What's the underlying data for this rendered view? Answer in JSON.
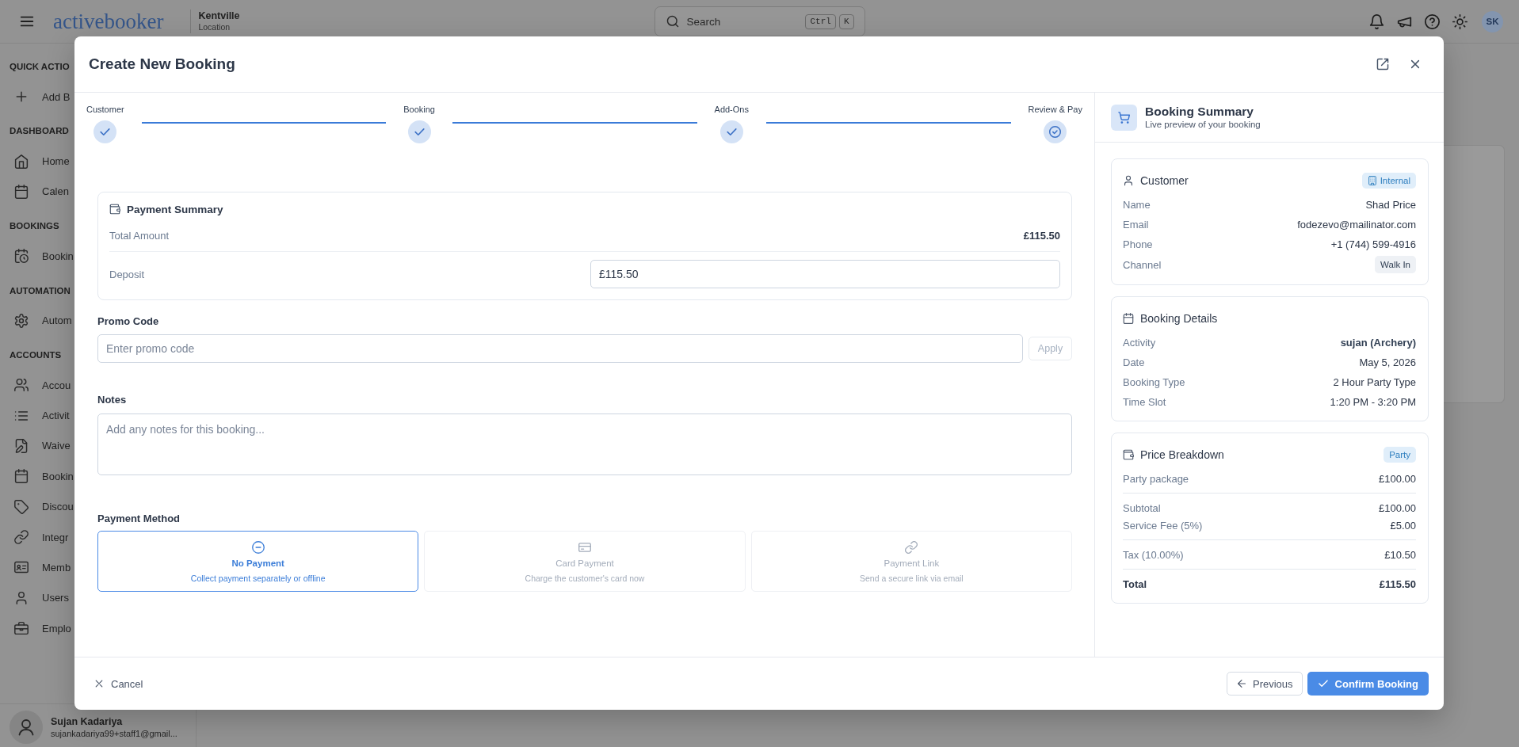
{
  "header": {
    "logo": "activebooker",
    "location": {
      "name": "Kentville",
      "label": "Location"
    },
    "search": {
      "placeholder": "Search",
      "shortcut": [
        "Ctrl",
        "K"
      ]
    },
    "user_initials": "SK"
  },
  "sidebar": {
    "sections": [
      {
        "title": "QUICK ACTIO",
        "items": [
          {
            "label": "Add B"
          }
        ]
      },
      {
        "title": "DASHBOARD",
        "items": [
          {
            "label": "Home"
          },
          {
            "label": "Calen"
          }
        ]
      },
      {
        "title": "BOOKINGS",
        "items": [
          {
            "label": "Bookin"
          }
        ]
      },
      {
        "title": "AUTOMATION",
        "items": [
          {
            "label": "Autom"
          }
        ]
      },
      {
        "title": "ACCOUNTS",
        "items": [
          {
            "label": "Accou"
          },
          {
            "label": "Activit"
          },
          {
            "label": "Waive"
          },
          {
            "label": "Bookin"
          },
          {
            "label": "Discou"
          },
          {
            "label": "Integr"
          },
          {
            "label": "Memb"
          },
          {
            "label": "Users"
          },
          {
            "label": "Emplo"
          }
        ]
      }
    ],
    "user": {
      "name": "Sujan Kadariya",
      "email": "sujankadariya99+staff1@gmail..."
    }
  },
  "modal": {
    "title": "Create New Booking",
    "steps": [
      {
        "label": "Customer",
        "completed": true
      },
      {
        "label": "Booking",
        "completed": true
      },
      {
        "label": "Add-Ons",
        "completed": true
      },
      {
        "label": "Review & Pay",
        "completed": false
      }
    ],
    "payment_summary": {
      "title": "Payment Summary",
      "total_label": "Total Amount",
      "total": "£115.50",
      "deposit_label": "Deposit",
      "deposit": "£115.50"
    },
    "promo": {
      "label": "Promo Code",
      "placeholder": "Enter promo code",
      "button": {
        "label": "Apply",
        "disabled": true
      }
    },
    "notes": {
      "label": "Notes",
      "placeholder": "Add any notes for this booking..."
    },
    "payment_method": {
      "label": "Payment Method",
      "options": [
        {
          "title": "No Payment",
          "description": "Collect payment separately or offline",
          "selected": true
        },
        {
          "title": "Card Payment",
          "description": "Charge the customer's card now",
          "selected": false
        },
        {
          "title": "Payment Link",
          "description": "Send a secure link via email",
          "selected": false
        }
      ]
    },
    "footer": {
      "cancel": "Cancel",
      "previous": "Previous",
      "confirm": "Confirm Booking"
    },
    "summary": {
      "title": "Booking Summary",
      "subtitle": "Live preview of your booking",
      "cards": [
        {
          "title": "Customer",
          "badge": {
            "label": "Internal",
            "kind": "icon"
          },
          "rows": [
            {
              "kind": "text",
              "label": "Name",
              "value": "Shad Price"
            },
            {
              "kind": "text",
              "label": "Email",
              "value": "fodezevo@mailinator.com"
            },
            {
              "kind": "text",
              "label": "Phone",
              "value": "+1 (744) 599-4916"
            },
            {
              "kind": "tag",
              "label": "Channel",
              "value": "Walk In"
            }
          ]
        },
        {
          "title": "Booking Details",
          "rows": [
            {
              "kind": "text",
              "label": "Activity",
              "value": "sujan (Archery)",
              "emphasis": true
            },
            {
              "kind": "text",
              "label": "Date",
              "value": "May 5, 2026"
            },
            {
              "kind": "text",
              "label": "Booking Type",
              "value": "2 Hour Party Type"
            },
            {
              "kind": "text",
              "label": "Time Slot",
              "value": "1:20 PM - 3:20 PM"
            }
          ]
        },
        {
          "title": "Price Breakdown",
          "badge": {
            "label": "Party",
            "kind": "plain"
          },
          "rows": [
            {
              "kind": "line",
              "label": "Party package",
              "value": "£100.00"
            },
            {
              "kind": "divider"
            },
            {
              "kind": "line",
              "label": "Subtotal",
              "value": "£100.00"
            },
            {
              "kind": "line",
              "label": "Service Fee (5%)",
              "value": "£5.00"
            },
            {
              "kind": "divider"
            },
            {
              "kind": "line",
              "label": "Tax (10.00%)",
              "value": "£10.50"
            },
            {
              "kind": "divider"
            },
            {
              "kind": "total",
              "label": "Total",
              "value": "£115.50"
            }
          ]
        }
      ]
    }
  }
}
